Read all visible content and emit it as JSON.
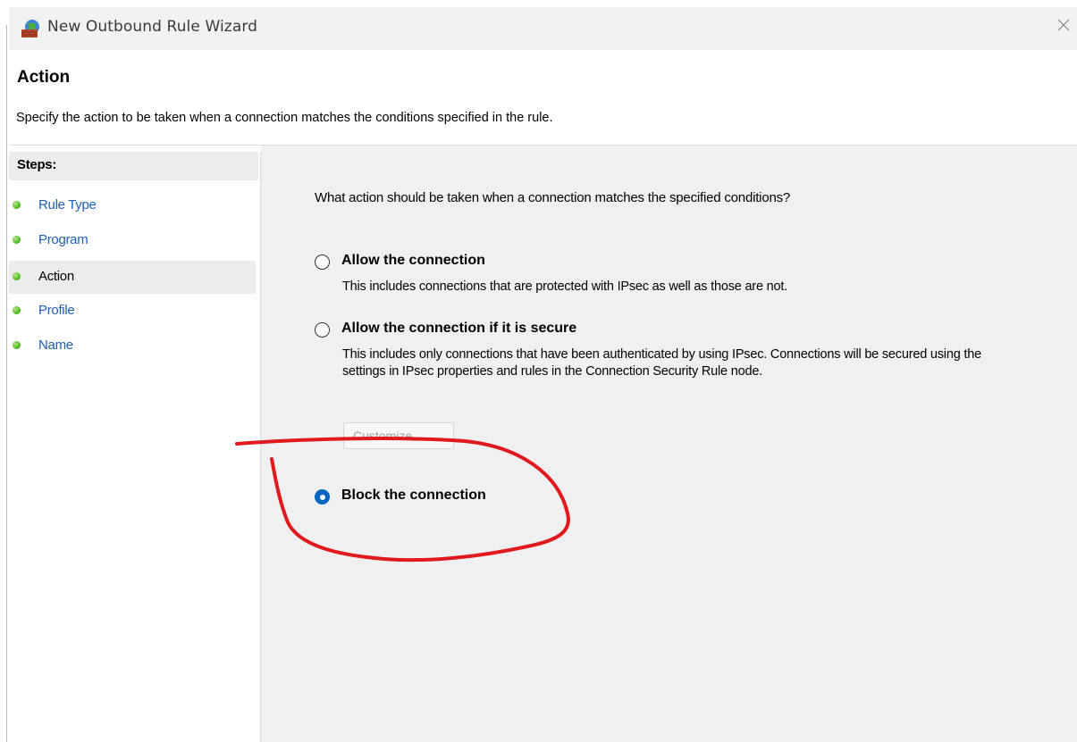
{
  "window": {
    "title": "New Outbound Rule Wizard",
    "icon": "firewall-globe-icon",
    "close_icon": "close-icon"
  },
  "header": {
    "title": "Action",
    "description": "Specify the action to be taken when a connection matches the conditions specified in the rule."
  },
  "steps": {
    "header": "Steps:",
    "items": [
      {
        "label": "Rule Type",
        "active": false
      },
      {
        "label": "Program",
        "active": false
      },
      {
        "label": "Action",
        "active": true
      },
      {
        "label": "Profile",
        "active": false
      },
      {
        "label": "Name",
        "active": false
      }
    ]
  },
  "content": {
    "question": "What action should be taken when a connection matches the specified conditions?",
    "options": [
      {
        "label": "Allow the connection",
        "description": "This includes connections that are protected with IPsec as well as those are not.",
        "selected": false
      },
      {
        "label": "Allow the connection if it is secure",
        "description": "This includes only connections that have been authenticated by using IPsec.  Connections will be secured using the settings in IPsec properties and rules in the Connection Security Rule node.",
        "selected": false
      },
      {
        "label": "Block the connection",
        "description": "",
        "selected": true
      }
    ],
    "customize_button": "Customize...",
    "customize_enabled": false
  },
  "colors": {
    "link": "#1f5fb4",
    "radio_selected": "#0067c0",
    "annotation": "#e0191e",
    "content_bg": "#f0f0f0"
  }
}
